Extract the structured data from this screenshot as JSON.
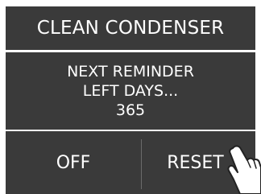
{
  "header": {
    "title": "CLEAN CONDENSER"
  },
  "message": {
    "line1": "NEXT REMINDER",
    "line2": "LEFT DAYS...",
    "days": "365"
  },
  "buttons": {
    "off_label": "OFF",
    "reset_label": "RESET"
  },
  "colors": {
    "panel_background": "#3a3a3a",
    "text": "#ffffff",
    "divider": "#6a6a6a"
  },
  "icons": {
    "pointer": "hand-pointer-icon"
  }
}
